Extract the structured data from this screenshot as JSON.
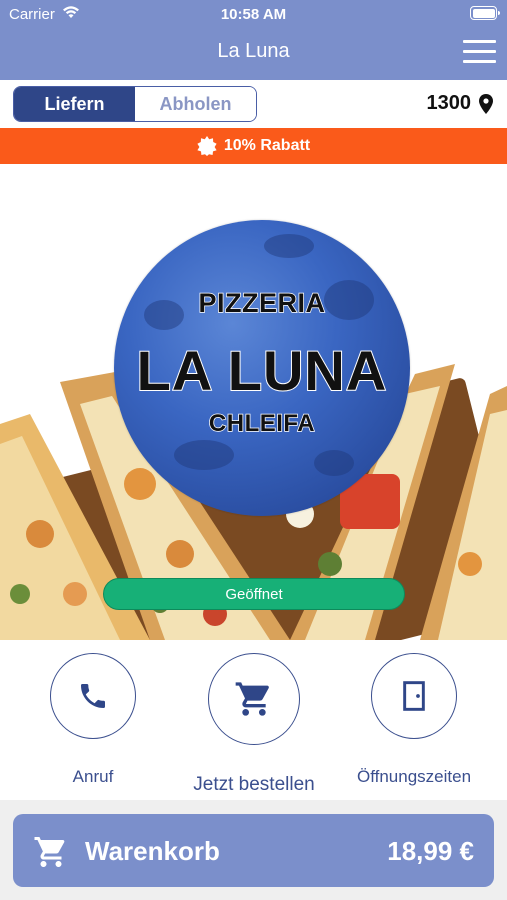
{
  "status_bar": {
    "carrier": "Carrier",
    "time": "10:58 AM"
  },
  "header": {
    "title": "La Luna"
  },
  "order_mode": {
    "options": [
      "Liefern",
      "Abholen"
    ],
    "selected": "Liefern"
  },
  "location": {
    "postal_code": "1300"
  },
  "promo": {
    "text": "10% Rabatt"
  },
  "logo": {
    "line1": "PIZZERIA",
    "line2": "LA LUNA",
    "line3": "CHLEIFA"
  },
  "status": {
    "label": "Geöffnet"
  },
  "actions": [
    {
      "label": "Anruf",
      "icon": "phone-icon"
    },
    {
      "label": "Jetzt bestellen",
      "icon": "cart-icon"
    },
    {
      "label": "Öffnungszeiten",
      "icon": "door-icon"
    }
  ],
  "cart": {
    "label": "Warenkorb",
    "total": "18,99 €"
  },
  "colors": {
    "header": "#7b8fcb",
    "accent_dark": "#2f4688",
    "promo": "#fa5a1a",
    "open": "#17b077"
  }
}
